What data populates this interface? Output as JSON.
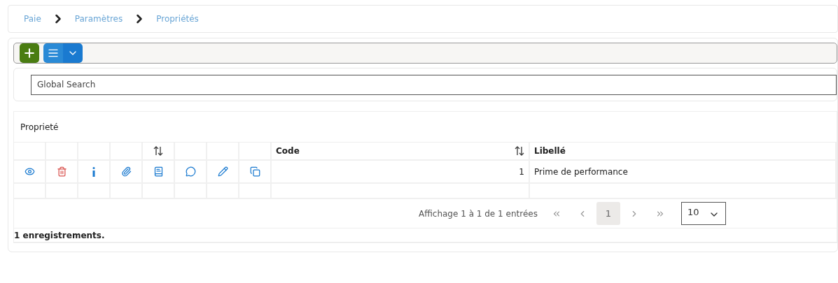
{
  "breadcrumb": [
    {
      "label": "Paie"
    },
    {
      "label": "Paramètres"
    },
    {
      "label": "Propriétés"
    }
  ],
  "search": {
    "placeholder": "Global Search"
  },
  "table": {
    "title": "Proprieté",
    "action_columns": [
      {
        "sortable": false
      },
      {
        "sortable": false
      },
      {
        "sortable": false
      },
      {
        "sortable": false
      },
      {
        "sortable": true
      },
      {
        "sortable": false
      },
      {
        "sortable": false
      },
      {
        "sortable": false
      }
    ],
    "columns": [
      {
        "label": "Code",
        "sortable": true
      },
      {
        "label": "Libellé",
        "sortable": false
      }
    ],
    "actions": [
      {
        "kind": "view"
      },
      {
        "kind": "delete"
      },
      {
        "kind": "info"
      },
      {
        "kind": "attach"
      },
      {
        "kind": "document"
      },
      {
        "kind": "comment"
      },
      {
        "kind": "edit"
      },
      {
        "kind": "copy"
      }
    ],
    "rows": [
      {
        "code": "1",
        "libelle": "Prime de performance"
      }
    ]
  },
  "pagination": {
    "summary": "Affichage 1 à 1 de 1 entrées",
    "pages": [
      {
        "label": "1",
        "selected": true
      }
    ],
    "page_size": "10"
  },
  "footer": "1 enregistrements."
}
